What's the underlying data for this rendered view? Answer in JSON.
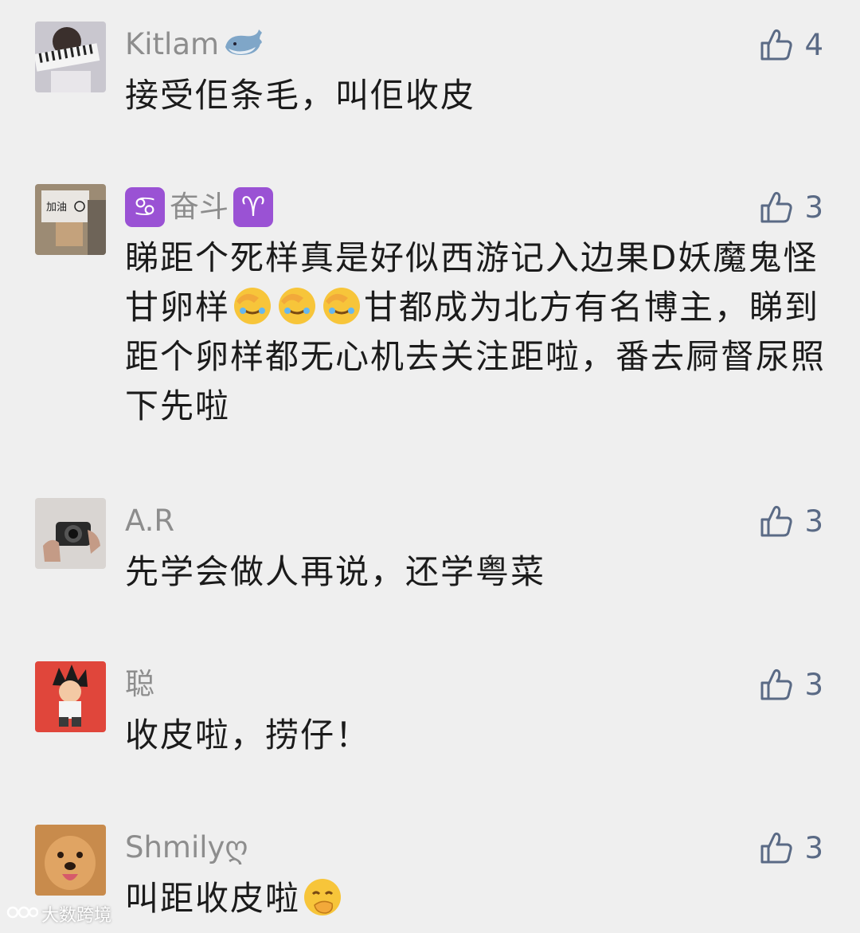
{
  "comments": [
    {
      "name": "Kitlam",
      "name_suffix_icon": "whale-icon",
      "likes": "4",
      "text": "接受佢条毛，叫佢收皮"
    },
    {
      "name": "奋斗",
      "name_prefix_icon": "cancer-zodiac-icon",
      "name_suffix_icon": "aries-zodiac-icon",
      "likes": "3",
      "text_part1": "睇距个死样真是好似西游记入边果D妖魔鬼怪甘卵样",
      "text_emojis": [
        "facepalm-crying-emoji",
        "facepalm-crying-emoji",
        "facepalm-crying-emoji"
      ],
      "text_part2": "甘都成为北方有名博主，睇到距个卵样都无心机去关注距啦，番去屙督尿照下先啦"
    },
    {
      "name": "A.R",
      "likes": "3",
      "text": "先学会做人再说，还学粤菜"
    },
    {
      "name": "聪",
      "likes": "3",
      "text": "收皮啦，捞仔！"
    },
    {
      "name": "Shmilyღ",
      "likes": "3",
      "text": "叫距收皮啦",
      "text_suffix_icon": "hand-over-mouth-emoji"
    }
  ],
  "icons": {
    "like": "thumbs-up-icon"
  },
  "watermark": "大数跨境",
  "colors": {
    "background": "#efefef",
    "like": "#5a6a85",
    "name": "#8d8d8d",
    "text": "#1b1b1b"
  }
}
